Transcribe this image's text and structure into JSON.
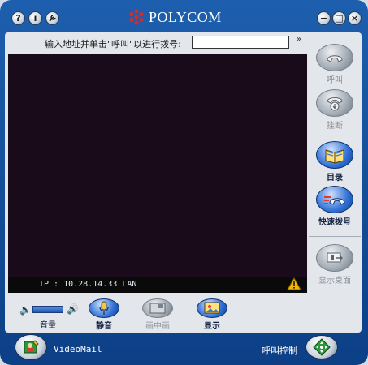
{
  "titlebar": {
    "logo_text": "POLYCOM",
    "help_glyph": "?",
    "info_glyph": "i",
    "settings_glyph": "🔧",
    "minimize_glyph": "−",
    "restore_glyph": "□",
    "close_glyph": "×"
  },
  "address": {
    "label": "输入地址并单击\"呼叫\"以进行拨号:",
    "value": "",
    "more_glyph": "»"
  },
  "video": {
    "status_text": "IP : 10.28.14.33 LAN"
  },
  "side_buttons": [
    {
      "label": "呼叫",
      "icon": "phone-icon",
      "enabled": false
    },
    {
      "label": "挂断",
      "icon": "hangup-icon",
      "enabled": false
    },
    {
      "label": "目录",
      "icon": "directory-book-icon",
      "enabled": true
    },
    {
      "label": "快速拨号",
      "icon": "speed-dial-icon",
      "enabled": true
    },
    {
      "label": "显示桌面",
      "icon": "show-desktop-icon",
      "enabled": false
    }
  ],
  "controls": {
    "volume_label": "音量",
    "mute_label": "静音",
    "pip_label": "画中画",
    "display_label": "显示"
  },
  "bottom": {
    "videomail_label": "VideoMail",
    "call_control_label": "呼叫控制"
  },
  "colors": {
    "frame": "#0c3f86",
    "video_bg": "#1a0b1b",
    "accent_blue": "#2f6fd4"
  }
}
